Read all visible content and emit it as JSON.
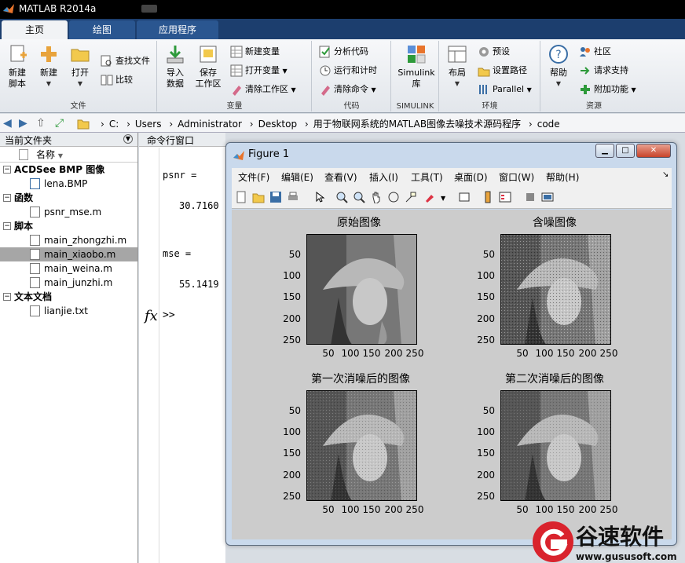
{
  "app": {
    "title": "MATLAB R2014a"
  },
  "ribbon_tabs": [
    {
      "label": "主页",
      "active": true
    },
    {
      "label": "绘图",
      "active": false
    },
    {
      "label": "应用程序",
      "active": false
    }
  ],
  "ribbon": {
    "file_group": {
      "label": "文件",
      "new_script": "新建\n脚本",
      "new": "新建",
      "open": "打开",
      "find_files": "查找文件",
      "compare": "比较"
    },
    "variable_group": {
      "label": "变量",
      "import": "导入\n数据",
      "save_ws": "保存\n工作区",
      "new_var": "新建变量",
      "open_var": "打开变量",
      "clear_ws": "清除工作区"
    },
    "code_group": {
      "label": "代码",
      "analyze": "分析代码",
      "run_time": "运行和计时",
      "clear_cmd": "清除命令"
    },
    "simulink_group": {
      "label": "SIMULINK",
      "simulink_lib": "Simulink\n库"
    },
    "env_group": {
      "label": "环境",
      "layout": "布局",
      "prefs": "预设",
      "set_path": "设置路径",
      "parallel": "Parallel"
    },
    "resources_group": {
      "label": "资源",
      "help": "帮助",
      "community": "社区",
      "support": "请求支持",
      "addons": "附加功能"
    }
  },
  "address": {
    "crumbs": [
      "C:",
      "Users",
      "Administrator",
      "Desktop",
      "用于物联网系统的MATLAB图像去噪技术源码程序",
      "code"
    ]
  },
  "file_browser": {
    "header": "当前文件夹",
    "name_col": "名称",
    "groups": [
      {
        "label": "ACDSee BMP 图像",
        "files": [
          {
            "name": "lena.BMP",
            "selected": false
          }
        ]
      },
      {
        "label": "函数",
        "files": [
          {
            "name": "psnr_mse.m",
            "selected": false
          }
        ]
      },
      {
        "label": "脚本",
        "files": [
          {
            "name": "main_zhongzhi.m",
            "selected": false
          },
          {
            "name": "main_xiaobo.m",
            "selected": true
          },
          {
            "name": "main_weina.m",
            "selected": false
          },
          {
            "name": "main_junzhi.m",
            "selected": false
          }
        ]
      },
      {
        "label": "文本文档",
        "files": [
          {
            "name": "lianjie.txt",
            "selected": false
          }
        ]
      }
    ]
  },
  "command_window": {
    "header": "命令行窗口",
    "lines": [
      {
        "text": "psnr ="
      },
      {
        "text": "30.7160"
      },
      {
        "text": "mse ="
      },
      {
        "text": "55.1419"
      }
    ],
    "prompt": ">>"
  },
  "figure": {
    "title": "Figure 1",
    "menus": [
      "文件(F)",
      "编辑(E)",
      "查看(V)",
      "插入(I)",
      "工具(T)",
      "桌面(D)",
      "窗口(W)",
      "帮助(H)"
    ],
    "axes": [
      {
        "title": "原始图像"
      },
      {
        "title": "含噪图像"
      },
      {
        "title": "第一次消噪后的图像"
      },
      {
        "title": "第二次消噪后的图像"
      }
    ],
    "yticks": [
      "50",
      "100",
      "150",
      "200",
      "250"
    ],
    "xticks": [
      "50",
      "100",
      "150",
      "200",
      "250"
    ]
  },
  "watermark": {
    "text": "谷速软件",
    "url": "www.gususoft.com"
  }
}
